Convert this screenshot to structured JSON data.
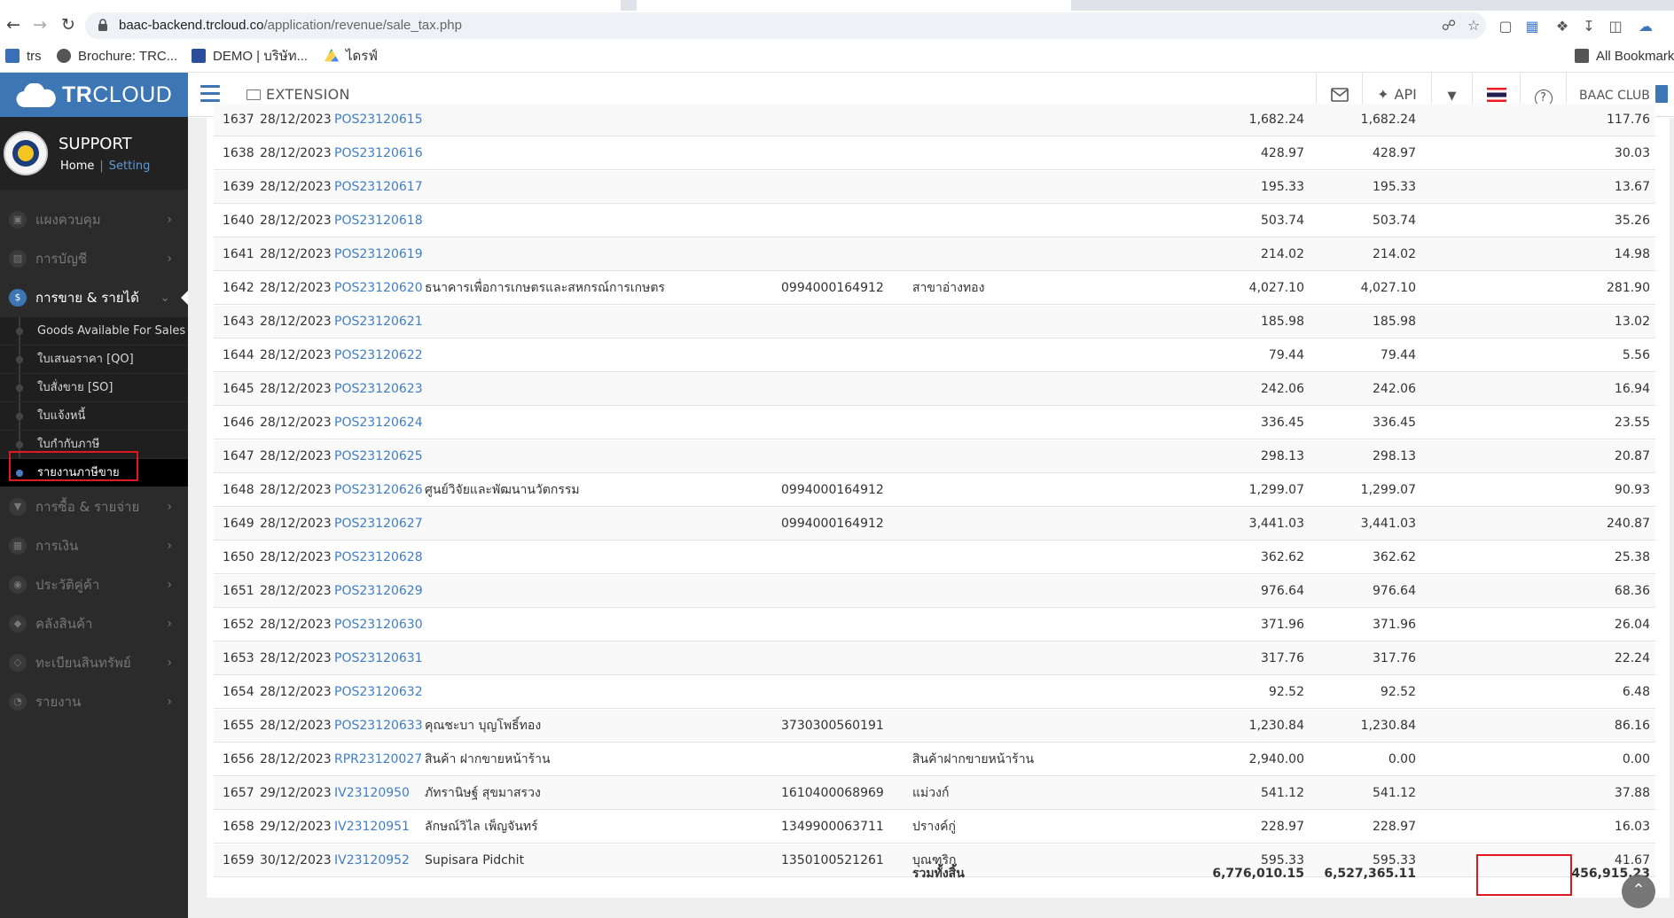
{
  "browser": {
    "url_host": "baac-backend.trcloud.co",
    "url_path": "/application/revenue/sale_tax.php",
    "bookmarks": [
      {
        "label": "trs",
        "color": "#3b6fb6"
      },
      {
        "label": "Brochure: TRC...",
        "color": "#555555"
      },
      {
        "label": "DEMO | บริษัท...",
        "color": "#2a4e99"
      },
      {
        "label": "ไดรฟ์",
        "color": "#1fa463"
      }
    ],
    "all_bookmarks": "All Bookmarks"
  },
  "header": {
    "brand_bold": "TR",
    "brand_rest": "CLOUD",
    "extension": "EXTENSION",
    "api": "API",
    "club": "BAAC CLUB",
    "brand_color": "#3c76b5"
  },
  "profile": {
    "name": "SUPPORT",
    "home": "Home",
    "separator": "|",
    "setting": "Setting"
  },
  "menu": [
    {
      "label": "แผงควบคุม",
      "icon": "monitor-icon"
    },
    {
      "label": "การบัญชี",
      "icon": "book-icon"
    },
    {
      "label": "การขาย & รายได้",
      "icon": "dollar-icon",
      "active": true
    },
    {
      "label": "การซื้อ & รายจ่าย",
      "icon": "cart-icon"
    },
    {
      "label": "การเงิน",
      "icon": "calendar-icon"
    },
    {
      "label": "ประวัติคู่ค้า",
      "icon": "contact-icon"
    },
    {
      "label": "คลังสินค้า",
      "icon": "boxes-icon"
    },
    {
      "label": "ทะเบียนสินทรัพย์",
      "icon": "diamond-icon"
    },
    {
      "label": "รายงาน",
      "icon": "chart-icon"
    }
  ],
  "submenu": [
    {
      "label": "Goods Available For Sales"
    },
    {
      "label": "ใบเสนอราคา [QO]"
    },
    {
      "label": "ใบสั่งขาย [SO]"
    },
    {
      "label": "ใบแจ้งหนี้"
    },
    {
      "label": "ใบกำกับภาษี"
    },
    {
      "label": "รายงานภาษีขาย",
      "active": true
    }
  ],
  "table": {
    "rows": [
      {
        "no": "1637",
        "date": "28/12/2023",
        "doc": "POS23120615",
        "name": "",
        "tax_id": "",
        "branch": "",
        "amount": "1,682.24",
        "base": "1,682.24",
        "vat": "117.76"
      },
      {
        "no": "1638",
        "date": "28/12/2023",
        "doc": "POS23120616",
        "name": "",
        "tax_id": "",
        "branch": "",
        "amount": "428.97",
        "base": "428.97",
        "vat": "30.03"
      },
      {
        "no": "1639",
        "date": "28/12/2023",
        "doc": "POS23120617",
        "name": "",
        "tax_id": "",
        "branch": "",
        "amount": "195.33",
        "base": "195.33",
        "vat": "13.67"
      },
      {
        "no": "1640",
        "date": "28/12/2023",
        "doc": "POS23120618",
        "name": "",
        "tax_id": "",
        "branch": "",
        "amount": "503.74",
        "base": "503.74",
        "vat": "35.26"
      },
      {
        "no": "1641",
        "date": "28/12/2023",
        "doc": "POS23120619",
        "name": "",
        "tax_id": "",
        "branch": "",
        "amount": "214.02",
        "base": "214.02",
        "vat": "14.98"
      },
      {
        "no": "1642",
        "date": "28/12/2023",
        "doc": "POS23120620",
        "name": "ธนาคารเพื่อการเกษตรและสหกรณ์การเกษตร",
        "tax_id": "0994000164912",
        "branch": "สาขาอ่างทอง",
        "amount": "4,027.10",
        "base": "4,027.10",
        "vat": "281.90"
      },
      {
        "no": "1643",
        "date": "28/12/2023",
        "doc": "POS23120621",
        "name": "",
        "tax_id": "",
        "branch": "",
        "amount": "185.98",
        "base": "185.98",
        "vat": "13.02"
      },
      {
        "no": "1644",
        "date": "28/12/2023",
        "doc": "POS23120622",
        "name": "",
        "tax_id": "",
        "branch": "",
        "amount": "79.44",
        "base": "79.44",
        "vat": "5.56"
      },
      {
        "no": "1645",
        "date": "28/12/2023",
        "doc": "POS23120623",
        "name": "",
        "tax_id": "",
        "branch": "",
        "amount": "242.06",
        "base": "242.06",
        "vat": "16.94"
      },
      {
        "no": "1646",
        "date": "28/12/2023",
        "doc": "POS23120624",
        "name": "",
        "tax_id": "",
        "branch": "",
        "amount": "336.45",
        "base": "336.45",
        "vat": "23.55"
      },
      {
        "no": "1647",
        "date": "28/12/2023",
        "doc": "POS23120625",
        "name": "",
        "tax_id": "",
        "branch": "",
        "amount": "298.13",
        "base": "298.13",
        "vat": "20.87"
      },
      {
        "no": "1648",
        "date": "28/12/2023",
        "doc": "POS23120626",
        "name": "ศูนย์วิจัยและพัฒนานวัตกรรม",
        "tax_id": "0994000164912",
        "branch": "",
        "amount": "1,299.07",
        "base": "1,299.07",
        "vat": "90.93"
      },
      {
        "no": "1649",
        "date": "28/12/2023",
        "doc": "POS23120627",
        "name": "",
        "tax_id": "0994000164912",
        "branch": "",
        "amount": "3,441.03",
        "base": "3,441.03",
        "vat": "240.87"
      },
      {
        "no": "1650",
        "date": "28/12/2023",
        "doc": "POS23120628",
        "name": "",
        "tax_id": "",
        "branch": "",
        "amount": "362.62",
        "base": "362.62",
        "vat": "25.38"
      },
      {
        "no": "1651",
        "date": "28/12/2023",
        "doc": "POS23120629",
        "name": "",
        "tax_id": "",
        "branch": "",
        "amount": "976.64",
        "base": "976.64",
        "vat": "68.36"
      },
      {
        "no": "1652",
        "date": "28/12/2023",
        "doc": "POS23120630",
        "name": "",
        "tax_id": "",
        "branch": "",
        "amount": "371.96",
        "base": "371.96",
        "vat": "26.04"
      },
      {
        "no": "1653",
        "date": "28/12/2023",
        "doc": "POS23120631",
        "name": "",
        "tax_id": "",
        "branch": "",
        "amount": "317.76",
        "base": "317.76",
        "vat": "22.24"
      },
      {
        "no": "1654",
        "date": "28/12/2023",
        "doc": "POS23120632",
        "name": "",
        "tax_id": "",
        "branch": "",
        "amount": "92.52",
        "base": "92.52",
        "vat": "6.48"
      },
      {
        "no": "1655",
        "date": "28/12/2023",
        "doc": "POS23120633",
        "name": "คุณชะบา บุญโพธิ์ทอง",
        "tax_id": "3730300560191",
        "branch": "",
        "amount": "1,230.84",
        "base": "1,230.84",
        "vat": "86.16"
      },
      {
        "no": "1656",
        "date": "28/12/2023",
        "doc": "RPR23120027",
        "name": "สินค้า ฝากขายหน้าร้าน",
        "tax_id": "",
        "branch": "สินค้าฝากขายหน้าร้าน",
        "amount": "2,940.00",
        "base": "0.00",
        "vat": "0.00"
      },
      {
        "no": "1657",
        "date": "29/12/2023",
        "doc": "IV23120950",
        "name": "ภัทรานิษฐ์ สุขมาสรวง",
        "tax_id": "1610400068969",
        "branch": "แม่วงก์",
        "amount": "541.12",
        "base": "541.12",
        "vat": "37.88"
      },
      {
        "no": "1658",
        "date": "29/12/2023",
        "doc": "IV23120951",
        "name": "ลักษณ์วิไล เพ็ญจันทร์",
        "tax_id": "1349900063711",
        "branch": "ปรางค์กู่",
        "amount": "228.97",
        "base": "228.97",
        "vat": "16.03"
      },
      {
        "no": "1659",
        "date": "30/12/2023",
        "doc": "IV23120952",
        "name": "Supisara Pidchit",
        "tax_id": "1350100521261",
        "branch": "บุณฑริก",
        "amount": "595.33",
        "base": "595.33",
        "vat": "41.67"
      }
    ],
    "total": {
      "label": "รวมทั้งสิ้น",
      "amount": "6,776,010.15",
      "base": "6,527,365.11",
      "vat": "456,915.23"
    }
  }
}
